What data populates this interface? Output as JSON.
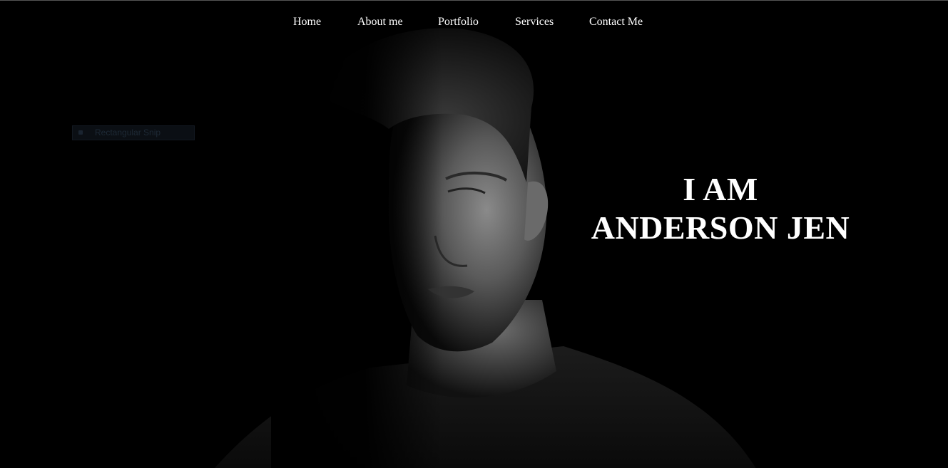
{
  "nav": {
    "items": [
      {
        "label": "Home"
      },
      {
        "label": "About me"
      },
      {
        "label": "Portfolio"
      },
      {
        "label": "Services"
      },
      {
        "label": "Contact Me"
      }
    ]
  },
  "snip_overlay": {
    "label": "Rectangular Snip"
  },
  "hero": {
    "line1": "I AM",
    "line2": "ANDERSON JEN"
  },
  "colors": {
    "background": "#000000",
    "text": "#ffffff"
  }
}
